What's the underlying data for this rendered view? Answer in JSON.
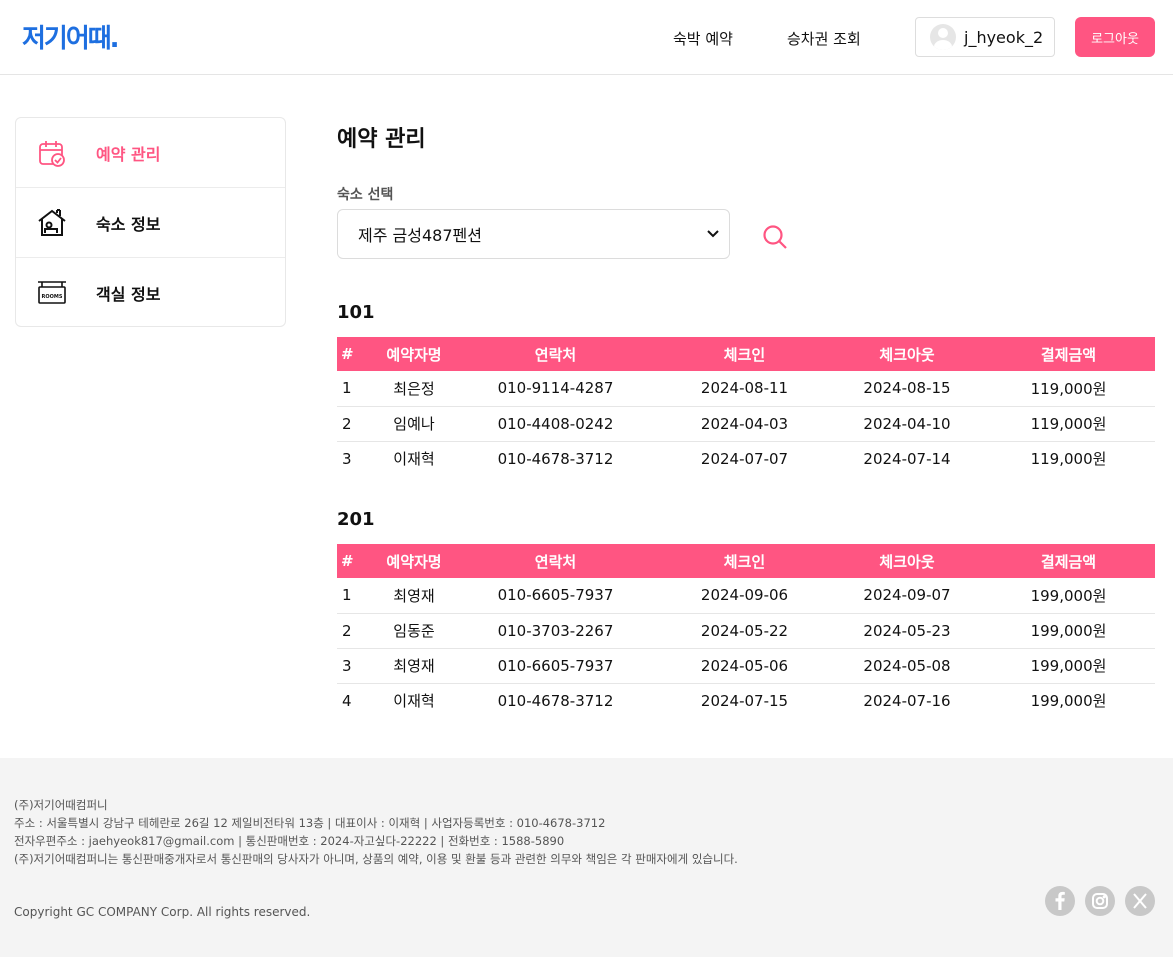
{
  "header": {
    "logo": "저기어때.",
    "nav": [
      "숙박 예약",
      "승차권 조회"
    ],
    "user_name": "j_hyeok_2",
    "logout_label": "로그아웃"
  },
  "sidebar": {
    "items": [
      {
        "label": "예약 관리",
        "icon": "calendar-check-icon",
        "active": true
      },
      {
        "label": "숙소 정보",
        "icon": "house-icon",
        "active": false
      },
      {
        "label": "객실 정보",
        "icon": "rooms-sign-icon",
        "active": false
      }
    ],
    "rooms_sign_text": "ROOMS"
  },
  "main": {
    "title": "예약 관리",
    "select_label": "숙소 선택",
    "selected_lodging": "제주 금성487펜션",
    "columns": [
      "#",
      "예약자명",
      "연락처",
      "체크인",
      "체크아웃",
      "결제금액"
    ],
    "rooms": [
      {
        "name": "101",
        "rows": [
          [
            "1",
            "최은정",
            "010-9114-4287",
            "2024-08-11",
            "2024-08-15",
            "119,000원"
          ],
          [
            "2",
            "임예나",
            "010-4408-0242",
            "2024-04-03",
            "2024-04-10",
            "119,000원"
          ],
          [
            "3",
            "이재혁",
            "010-4678-3712",
            "2024-07-07",
            "2024-07-14",
            "119,000원"
          ]
        ]
      },
      {
        "name": "201",
        "rows": [
          [
            "1",
            "최영재",
            "010-6605-7937",
            "2024-09-06",
            "2024-09-07",
            "199,000원"
          ],
          [
            "2",
            "임동준",
            "010-3703-2267",
            "2024-05-22",
            "2024-05-23",
            "199,000원"
          ],
          [
            "3",
            "최영재",
            "010-6605-7937",
            "2024-05-06",
            "2024-05-08",
            "199,000원"
          ],
          [
            "4",
            "이재혁",
            "010-4678-3712",
            "2024-07-15",
            "2024-07-16",
            "199,000원"
          ]
        ]
      }
    ]
  },
  "footer": {
    "lines": [
      "(주)저기어때컴퍼니",
      "주소 : 서울특별시 강남구 테헤란로 26길 12 제일비전타워 13층 | 대표이사 : 이재혁 | 사업자등록번호 : 010-4678-3712",
      "전자우편주소 : jaehyeok817@gmail.com | 통신판매번호 : 2024-자고싶다-22222 | 전화번호 : 1588-5890",
      "(주)저기어때컴퍼니는 통신판매중개자로서 통신판매의 당사자가 아니며, 상품의 예약, 이용 및 환불 등과 관련한 의무와 책임은 각 판매자에게 있습니다."
    ],
    "copyright": "Copyright GC COMPANY Corp. All rights reserved.",
    "social": [
      "facebook-icon",
      "instagram-icon",
      "x-icon"
    ]
  },
  "colors": {
    "brand_blue": "#1e6fe0",
    "accent_pink": "#ff5582"
  }
}
